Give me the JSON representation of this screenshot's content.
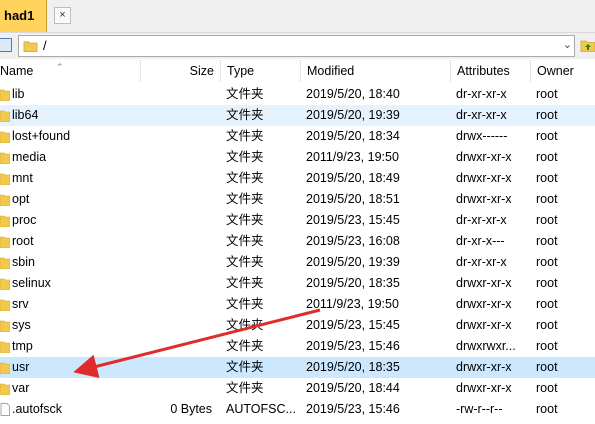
{
  "tab": {
    "label": "had1",
    "close": "×"
  },
  "path": {
    "value": "/"
  },
  "columns": {
    "name": "Name",
    "size": "Size",
    "type": "Type",
    "modified": "Modified",
    "attributes": "Attributes",
    "owner": "Owner"
  },
  "files": [
    {
      "name": "lib",
      "size": "",
      "type": "文件夹",
      "modified": "2019/5/20, 18:40",
      "attributes": "dr-xr-xr-x",
      "owner": "root"
    },
    {
      "name": "lib64",
      "size": "",
      "type": "文件夹",
      "modified": "2019/5/20, 19:39",
      "attributes": "dr-xr-xr-x",
      "owner": "root"
    },
    {
      "name": "lost+found",
      "size": "",
      "type": "文件夹",
      "modified": "2019/5/20, 18:34",
      "attributes": "drwx------",
      "owner": "root"
    },
    {
      "name": "media",
      "size": "",
      "type": "文件夹",
      "modified": "2011/9/23, 19:50",
      "attributes": "drwxr-xr-x",
      "owner": "root"
    },
    {
      "name": "mnt",
      "size": "",
      "type": "文件夹",
      "modified": "2019/5/20, 18:49",
      "attributes": "drwxr-xr-x",
      "owner": "root"
    },
    {
      "name": "opt",
      "size": "",
      "type": "文件夹",
      "modified": "2019/5/20, 18:51",
      "attributes": "drwxr-xr-x",
      "owner": "root"
    },
    {
      "name": "proc",
      "size": "",
      "type": "文件夹",
      "modified": "2019/5/23, 15:45",
      "attributes": "dr-xr-xr-x",
      "owner": "root"
    },
    {
      "name": "root",
      "size": "",
      "type": "文件夹",
      "modified": "2019/5/23, 16:08",
      "attributes": "dr-xr-x---",
      "owner": "root"
    },
    {
      "name": "sbin",
      "size": "",
      "type": "文件夹",
      "modified": "2019/5/20, 19:39",
      "attributes": "dr-xr-xr-x",
      "owner": "root"
    },
    {
      "name": "selinux",
      "size": "",
      "type": "文件夹",
      "modified": "2019/5/20, 18:35",
      "attributes": "drwxr-xr-x",
      "owner": "root"
    },
    {
      "name": "srv",
      "size": "",
      "type": "文件夹",
      "modified": "2011/9/23, 19:50",
      "attributes": "drwxr-xr-x",
      "owner": "root"
    },
    {
      "name": "sys",
      "size": "",
      "type": "文件夹",
      "modified": "2019/5/23, 15:45",
      "attributes": "drwxr-xr-x",
      "owner": "root"
    },
    {
      "name": "tmp",
      "size": "",
      "type": "文件夹",
      "modified": "2019/5/23, 15:46",
      "attributes": "drwxrwxr...",
      "owner": "root"
    },
    {
      "name": "usr",
      "size": "",
      "type": "文件夹",
      "modified": "2019/5/20, 18:35",
      "attributes": "drwxr-xr-x",
      "owner": "root"
    },
    {
      "name": "var",
      "size": "",
      "type": "文件夹",
      "modified": "2019/5/20, 18:44",
      "attributes": "drwxr-xr-x",
      "owner": "root"
    },
    {
      "name": ".autofsck",
      "size": "0 Bytes",
      "type": "AUTOFSC...",
      "modified": "2019/5/23, 15:46",
      "attributes": "-rw-r--r--",
      "owner": "root"
    }
  ],
  "colors": {
    "folder": "#f2c94c",
    "selection": "#cce8ff",
    "hover": "#e5f3ff",
    "annotation_arrow": "#e02b2b",
    "tab": "#ffd35c"
  }
}
